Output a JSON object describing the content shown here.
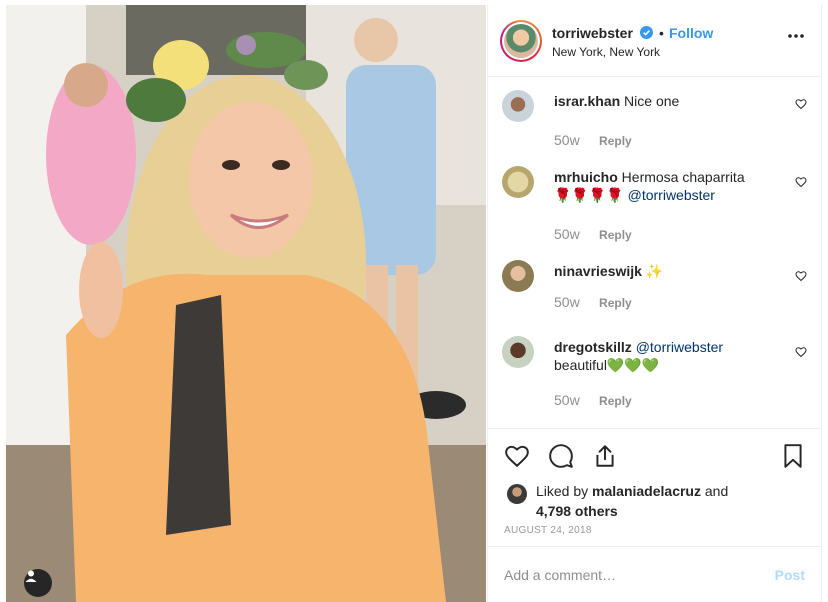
{
  "header": {
    "username": "torriwebster",
    "follow_label": "Follow",
    "separator": "•",
    "location": "New York, New York"
  },
  "comments": [
    {
      "user": "israr.khan",
      "text": "Nice one",
      "mention": "",
      "tail": "",
      "time": "50w",
      "reply": "Reply"
    },
    {
      "user": "mrhuicho",
      "text": "Hermosa chaparrita",
      "mention": "@torriwebster",
      "tail": "🌹🌹🌹🌹",
      "time": "50w",
      "reply": "Reply"
    },
    {
      "user": "ninavrieswijk",
      "text": "✨",
      "mention": "",
      "tail": "",
      "time": "50w",
      "reply": "Reply"
    },
    {
      "user": "dregotskillz",
      "text": "",
      "mention": "@torriwebster",
      "tail": "beautiful💚💚💚",
      "time": "50w",
      "reply": "Reply"
    }
  ],
  "likes": {
    "prefix": "Liked by",
    "user": "malaniadelacruz",
    "and": "and",
    "count": "4,798 others"
  },
  "date": "AUGUST 24, 2018",
  "add_comment": {
    "placeholder": "Add a comment…",
    "post_label": "Post"
  },
  "icons": [
    "heart-icon",
    "comment-icon",
    "share-icon",
    "bookmark-icon",
    "more-icon",
    "verified-icon",
    "user-tag-icon"
  ],
  "colors": {
    "accent": "#3897f0",
    "verified": "#3897f0",
    "post_disabled": "#b3dbff",
    "meta": "#8e8e8e"
  }
}
